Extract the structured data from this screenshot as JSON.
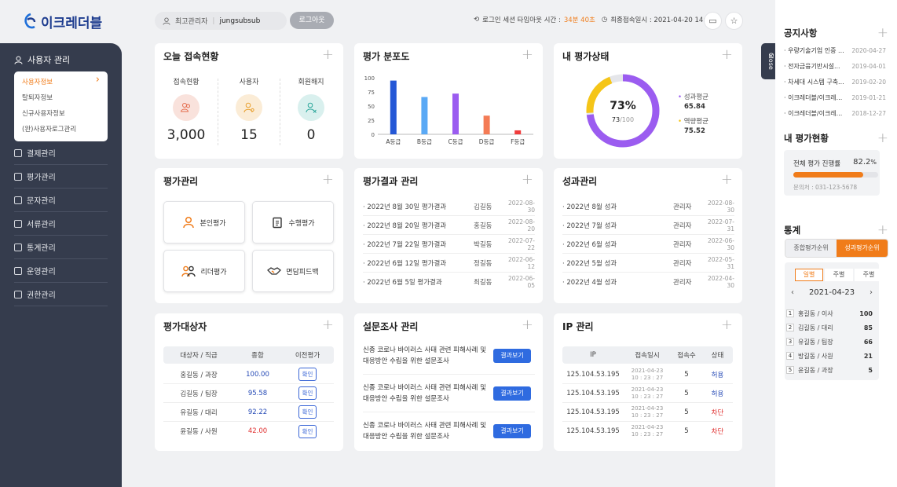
{
  "app": {
    "name": "이크레더블"
  },
  "sidebar": {
    "active_menu": "사용자 관리",
    "submenu": [
      "사용자정보",
      "탈퇴자정보",
      "신규사용자정보",
      "(완)사용자로그관리"
    ],
    "items": [
      {
        "label": "결제관리",
        "icon": "card-icon"
      },
      {
        "label": "평가관리",
        "icon": "document-icon"
      },
      {
        "label": "문자관리",
        "icon": "mail-icon"
      },
      {
        "label": "서류관리",
        "icon": "folder-icon"
      },
      {
        "label": "통계관리",
        "icon": "bar-chart-icon"
      },
      {
        "label": "운영관리",
        "icon": "monitor-icon"
      },
      {
        "label": "권한관리",
        "icon": "user-key-icon"
      }
    ]
  },
  "topbar": {
    "user_role": "최고관리자",
    "user_id": "jungsubsub",
    "logout": "로그아웃",
    "session_label": "로그인 세션 타임아웃 시간 :",
    "session_time": "34분 40초",
    "last_login_label": "최종접속일시 : 2021-04-20 14:51"
  },
  "today": {
    "title": "오늘 접속현황",
    "stats": [
      {
        "label": "접속현황",
        "value": "3,000",
        "color": "#f9e2dc"
      },
      {
        "label": "사용자",
        "value": "15",
        "color": "#fbecd6"
      },
      {
        "label": "회원해지",
        "value": "0",
        "color": "#d9f0ee"
      }
    ]
  },
  "distribution": {
    "title": "평가 분포도"
  },
  "chart_data": {
    "type": "bar",
    "categories": [
      "A등급",
      "B등급",
      "C등급",
      "D등급",
      "F등급"
    ],
    "values": [
      95,
      66,
      72,
      33,
      7
    ],
    "colors": [
      "#2457d6",
      "#5aa9f5",
      "#9b5cf0",
      "#f47b55",
      "#f03c3c"
    ],
    "ylim": [
      0,
      100
    ],
    "yticks": [
      0,
      25,
      50,
      75,
      100
    ]
  },
  "my_status": {
    "title": "내 평가상태",
    "percent": "73%",
    "score": "73",
    "max": "/100",
    "legend": [
      {
        "label": "성과평균",
        "value": "65.84",
        "color": "#9b5cf0"
      },
      {
        "label": "역량평균",
        "value": "75.52",
        "color": "#f5c518"
      }
    ]
  },
  "eval_manage": {
    "title": "평가관리",
    "buttons": [
      "본인평가",
      "수행평가",
      "리더평가",
      "면담피드백"
    ]
  },
  "eval_results": {
    "title": "평가결과 관리",
    "rows": [
      {
        "t": "· 2022년 8월 30일 평가결과",
        "n": "김길동",
        "d": "2022-08-30"
      },
      {
        "t": "· 2022년 8월 20일 평가결과",
        "n": "홍길동",
        "d": "2022-08-20"
      },
      {
        "t": "· 2022년 7월 22일 평가결과",
        "n": "박길동",
        "d": "2022-07-22"
      },
      {
        "t": "· 2022년 6월 12일 평가결과",
        "n": "정길동",
        "d": "2022-06-12"
      },
      {
        "t": "· 2022년 6월 5일 평가결과",
        "n": "최길동",
        "d": "2022-06-05"
      }
    ]
  },
  "performance": {
    "title": "성과관리",
    "rows": [
      {
        "t": "· 2022년 8월 성과",
        "n": "관리자",
        "d": "2022-08-30"
      },
      {
        "t": "· 2022년 7월 성과",
        "n": "관리자",
        "d": "2022-07-31"
      },
      {
        "t": "· 2022년 6월 성과",
        "n": "관리자",
        "d": "2022-06-30"
      },
      {
        "t": "· 2022년 5월 성과",
        "n": "관리자",
        "d": "2022-05-31"
      },
      {
        "t": "· 2022년 4월 성과",
        "n": "관리자",
        "d": "2022-04-30"
      }
    ]
  },
  "targets": {
    "title": "평가대상자",
    "headers": [
      "대상자 / 직급",
      "종합",
      "이전평가"
    ],
    "rows": [
      {
        "name": "홍길동 / 과장",
        "score": "100.00",
        "color": "#2348b5",
        "btn": "확인"
      },
      {
        "name": "김길동 / 팀장",
        "score": "95.58",
        "color": "#2348b5",
        "btn": "확인"
      },
      {
        "name": "유길동 / 대리",
        "score": "92.22",
        "color": "#2348b5",
        "btn": "확인"
      },
      {
        "name": "윤길동 / 사원",
        "score": "42.00",
        "color": "#e03030",
        "btn": "확인"
      }
    ]
  },
  "survey": {
    "title": "설문조사 관리",
    "rows": [
      {
        "t": "신종 코로나 바이러스 사태 관련 피해사례 및 대응방안 수립을 위한 설문조사",
        "btn": "결과보기"
      },
      {
        "t": "신종 코로나 바이러스 사태 관련 피해사례 및 대응방안 수립을 위한 설문조사",
        "btn": "결과보기"
      },
      {
        "t": "신종 코로나 바이러스 사태 관련 피해사례 및 대응방안 수립을 위한 설문조사",
        "btn": "결과보기"
      }
    ]
  },
  "ip": {
    "title": "IP 관리",
    "headers": [
      "IP",
      "접속일시",
      "접속수",
      "상태"
    ],
    "rows": [
      {
        "ip": "125.104.53.195",
        "date": "2021-04-23",
        "time": "10 : 23 : 27",
        "cnt": "5",
        "status": "허용",
        "color": "#2348b5"
      },
      {
        "ip": "125.104.53.195",
        "date": "2021-04-23",
        "time": "10 : 23 : 27",
        "cnt": "5",
        "status": "허용",
        "color": "#2348b5"
      },
      {
        "ip": "125.104.53.195",
        "date": "2021-04-23",
        "time": "10 : 23 : 27",
        "cnt": "5",
        "status": "차단",
        "color": "#e03030"
      },
      {
        "ip": "125.104.53.195",
        "date": "2021-04-23",
        "time": "10 : 23 : 27",
        "cnt": "5",
        "status": "차단",
        "color": "#e03030"
      }
    ]
  },
  "right": {
    "close": "Close",
    "notice_title": "공지사항",
    "notices": [
      {
        "t": "· 우량기술기업 인증 ...",
        "d": "2020-04-27"
      },
      {
        "t": "· 전자금융기반시설...",
        "d": "2019-04-01"
      },
      {
        "t": "· 차세대 시스템 구축...",
        "d": "2019-02-20"
      },
      {
        "t": "· 이크레더블/이크레...",
        "d": "2019-01-21"
      },
      {
        "t": "· 이크레더블/이크레...",
        "d": "2018-12-27"
      }
    ],
    "my_eval_title": "내 평가현황",
    "progress_label": "전체 평가 진행률",
    "progress_value": "82.2",
    "progress_unit": "%",
    "progress": 0.822,
    "contact": "문의처 : 031-123-5678",
    "stats_title": "통계",
    "tabs": [
      "종합평가순위",
      "성과평가순위"
    ],
    "period_tabs": [
      "일별",
      "주별",
      "주별"
    ],
    "date": "2021-04-23",
    "ranking": [
      {
        "no": "1",
        "name": "홍길동 / 이사",
        "score": "100"
      },
      {
        "no": "2",
        "name": "김길동 / 대리",
        "score": "85"
      },
      {
        "no": "3",
        "name": "유길동 / 팀장",
        "score": "66"
      },
      {
        "no": "4",
        "name": "방길동 / 사원",
        "score": "21"
      },
      {
        "no": "5",
        "name": "윤길동 / 과장",
        "score": "5"
      }
    ]
  }
}
